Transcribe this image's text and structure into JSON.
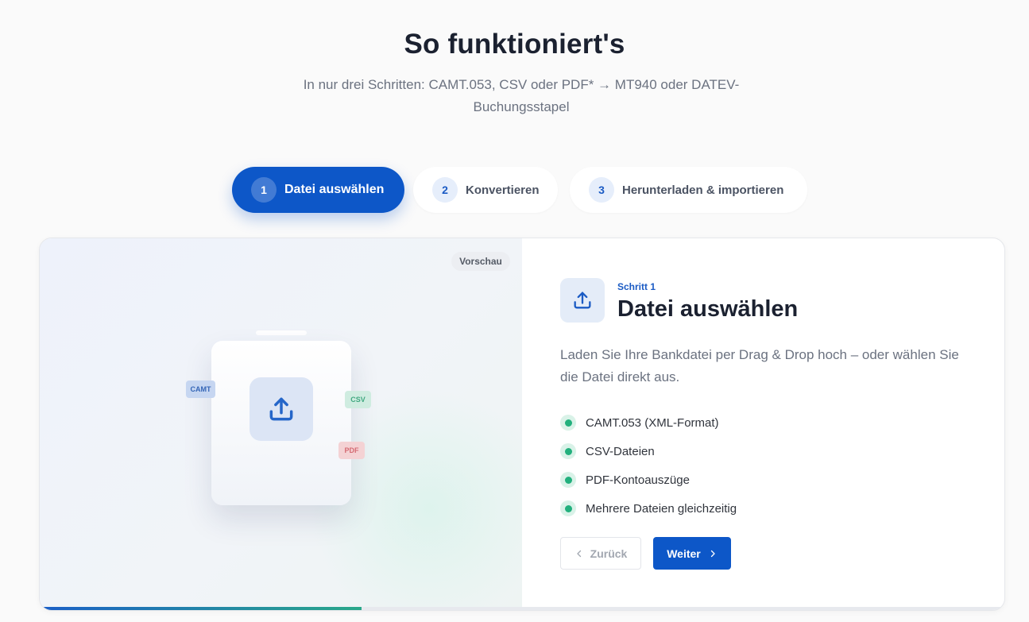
{
  "header": {
    "title": "So funktioniert's",
    "subtitle": "In nur drei Schritten: CAMT.053, CSV oder PDF* → MT940 oder DATEV-Buchungsstapel"
  },
  "steps": [
    {
      "number": "1",
      "label": "Datei auswählen",
      "active": true
    },
    {
      "number": "2",
      "label": "Konvertieren",
      "active": false
    },
    {
      "number": "3",
      "label": "Herunterladen & importieren",
      "active": false
    }
  ],
  "preview": {
    "badge": "Vorschau",
    "chips": {
      "camt": "CAMT",
      "csv": "CSV",
      "pdf": "PDF"
    },
    "icon": "upload-icon"
  },
  "detail": {
    "icon": "upload-icon",
    "step_label": "Schritt 1",
    "title": "Datei auswählen",
    "description": "Laden Sie Ihre Bankdatei per Drag & Drop hoch – oder wählen Sie die Datei direkt aus.",
    "features": [
      "CAMT.053 (XML-Format)",
      "CSV-Dateien",
      "PDF-Kontoauszüge",
      "Mehrere Dateien gleichzeitig"
    ],
    "back_label": "Zurück",
    "next_label": "Weiter"
  },
  "progress": {
    "fraction": 0.333
  },
  "colors": {
    "accent": "#0d57c8",
    "success": "#22b07d",
    "text": "#1b2130",
    "muted": "#6b7280"
  }
}
